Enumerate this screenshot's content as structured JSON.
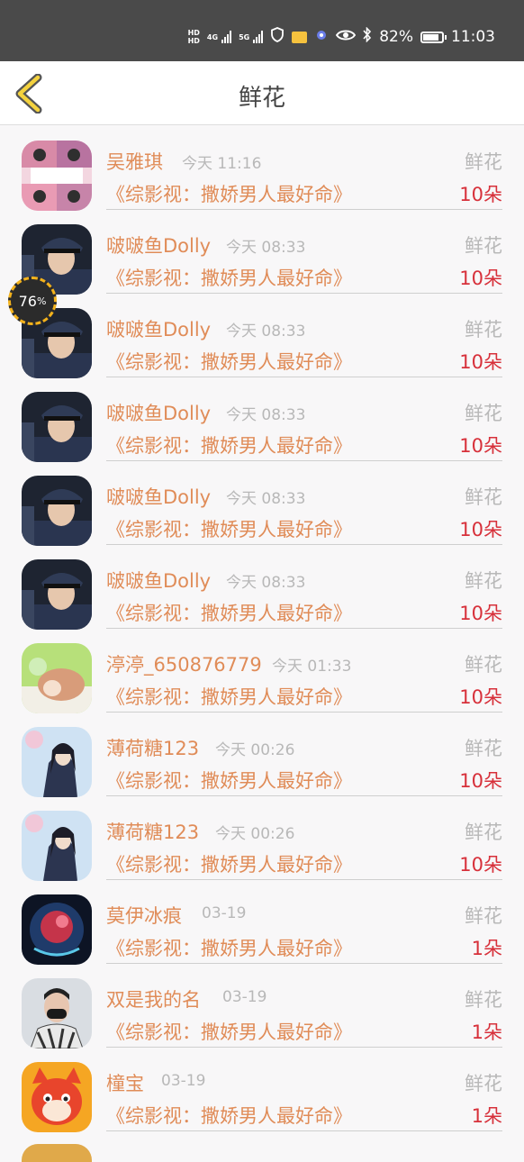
{
  "status_bar": {
    "hd_top": "HD",
    "hd_bottom": "HD",
    "net1": "4G",
    "net2": "5G",
    "battery_percent": "82%",
    "time": "11:03",
    "icons": [
      "signal-icon",
      "shield-icon",
      "message-icon",
      "app-icon",
      "eye-icon",
      "bluetooth-icon",
      "battery-icon"
    ]
  },
  "nav": {
    "title": "鲜花",
    "back_icon": "chevron-left-icon"
  },
  "float_badge": {
    "value": "76",
    "unit": "%"
  },
  "rows": [
    {
      "name": "吴雅琪",
      "time": "今天 11:16",
      "type": "鲜花",
      "book": "《综影视：撒娇男人最好命》",
      "count": "10朵",
      "avatar": "cartoon-girl"
    },
    {
      "name": "啵啵鱼Dolly",
      "time": "今天 08:33",
      "type": "鲜花",
      "book": "《综影视：撒娇男人最好命》",
      "count": "10朵",
      "avatar": "officer"
    },
    {
      "name": "啵啵鱼Dolly",
      "time": "今天 08:33",
      "type": "鲜花",
      "book": "《综影视：撒娇男人最好命》",
      "count": "10朵",
      "avatar": "officer"
    },
    {
      "name": "啵啵鱼Dolly",
      "time": "今天 08:33",
      "type": "鲜花",
      "book": "《综影视：撒娇男人最好命》",
      "count": "10朵",
      "avatar": "officer"
    },
    {
      "name": "啵啵鱼Dolly",
      "time": "今天 08:33",
      "type": "鲜花",
      "book": "《综影视：撒娇男人最好命》",
      "count": "10朵",
      "avatar": "officer"
    },
    {
      "name": "啵啵鱼Dolly",
      "time": "今天 08:33",
      "type": "鲜花",
      "book": "《综影视：撒娇男人最好命》",
      "count": "10朵",
      "avatar": "officer"
    },
    {
      "name": "渟渟_650876779",
      "time": "今天 01:33",
      "type": "鲜花",
      "book": "《综影视：撒娇男人最好命》",
      "count": "10朵",
      "avatar": "green-cartoon"
    },
    {
      "name": "薄荷糖123",
      "time": "今天 00:26",
      "type": "鲜花",
      "book": "《综影视：撒娇男人最好命》",
      "count": "10朵",
      "avatar": "ancient-man"
    },
    {
      "name": "薄荷糖123",
      "time": "今天 00:26",
      "type": "鲜花",
      "book": "《综影视：撒娇男人最好命》",
      "count": "10朵",
      "avatar": "ancient-man"
    },
    {
      "name": "莫伊冰痕",
      "time": "03-19",
      "type": "鲜花",
      "book": "《综影视：撒娇男人最好命》",
      "count": "1朵",
      "avatar": "dark-orb"
    },
    {
      "name": "双是我的名",
      "time": "03-19",
      "type": "鲜花",
      "book": "《综影视：撒娇男人最好命》",
      "count": "1朵",
      "avatar": "masked-man"
    },
    {
      "name": "橦宝",
      "time": "03-19",
      "type": "鲜花",
      "book": "《综影视：撒娇男人最好命》",
      "count": "1朵",
      "avatar": "red-fox"
    }
  ]
}
